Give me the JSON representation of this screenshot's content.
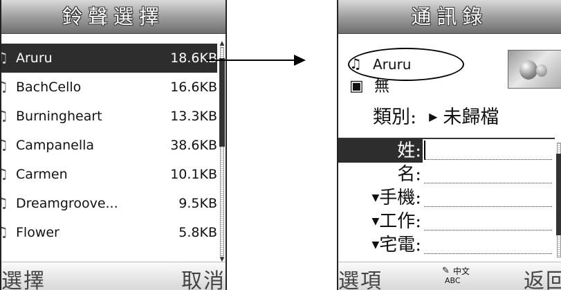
{
  "left_screen": {
    "title": "鈴聲選擇",
    "ringtones": [
      {
        "name": "Aruru",
        "size": "18.6KB",
        "selected": true
      },
      {
        "name": "BachCello",
        "size": "16.6KB"
      },
      {
        "name": "Burningheart",
        "size": "13.3KB"
      },
      {
        "name": "Campanella",
        "size": "38.6KB"
      },
      {
        "name": "Carmen",
        "size": "10.1KB"
      },
      {
        "name": "Dreamgroove...",
        "size": "9.5KB"
      },
      {
        "name": "Flower",
        "size": "5.8KB"
      }
    ],
    "softkey_left": "選擇",
    "softkey_right": "取消"
  },
  "right_screen": {
    "title": "通訊錄",
    "ringtone_value": "Aruru",
    "video_value": "無",
    "category_label": "類別:",
    "category_value": "未歸檔",
    "fields": [
      {
        "label": "姓:",
        "active": true,
        "expandable": false
      },
      {
        "label": "名:",
        "active": false,
        "expandable": false
      },
      {
        "label": "手機:",
        "active": false,
        "expandable": true
      },
      {
        "label": "工作:",
        "active": false,
        "expandable": true
      },
      {
        "label": "宅電:",
        "active": false,
        "expandable": true
      }
    ],
    "ime": {
      "chinese": "中文",
      "latin": "ABC"
    },
    "softkey_left": "選項",
    "softkey_right": "返回"
  },
  "icons": {
    "note": "music-note-icon",
    "ringtone": "ringtone-icon",
    "video": "video-icon",
    "pen": "pen-icon",
    "photo": "balloon-photo"
  }
}
